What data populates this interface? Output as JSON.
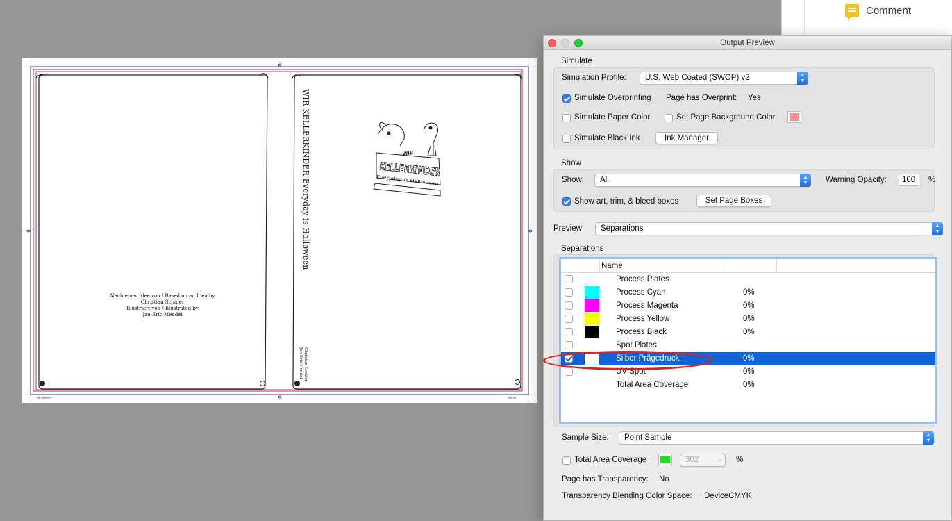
{
  "side_panel": {
    "comment_label": "Comment"
  },
  "document": {
    "credit_lines": [
      "Nach einer Idee von / Based on an Idea by",
      "Christian Schäfer",
      "Illustriert von / Illustrated by",
      "Jan-Eric Mendel"
    ],
    "spine_title": "WIR KELLERKINDER Everyday is Halloween",
    "spine_author_lines": [
      "Christian Schäfer",
      "Jan-Eric Mendel"
    ],
    "logo_word_top": "WIR",
    "logo_word_main": "KELLERKINDER",
    "logo_tagline": "Everyday is Halloween"
  },
  "dialog": {
    "title": "Output Preview",
    "simulate": {
      "section_label": "Simulate",
      "profile_label": "Simulation Profile:",
      "profile_value": "U.S. Web Coated (SWOP) v2",
      "overprint_label": "Simulate Overprinting",
      "overprint_checked": true,
      "page_overprint_label": "Page has Overprint:",
      "page_overprint_value": "Yes",
      "paper_color_label": "Simulate Paper Color",
      "bg_color_label": "Set Page Background Color",
      "bg_color": "#ee8f92",
      "black_ink_label": "Simulate Black Ink",
      "ink_manager_label": "Ink Manager"
    },
    "show": {
      "section_label": "Show",
      "show_label": "Show:",
      "show_value": "All",
      "warning_opacity_label": "Warning Opacity:",
      "warning_opacity_value": "100",
      "percent": "%",
      "boxes_label": "Show art, trim, & bleed boxes",
      "boxes_checked": true,
      "set_page_boxes_label": "Set Page Boxes"
    },
    "preview": {
      "label": "Preview:",
      "value": "Separations"
    },
    "separations": {
      "section_label": "Separations",
      "name_header": "Name",
      "rows": [
        {
          "name": "Process Plates",
          "color": "",
          "pct": ""
        },
        {
          "name": "Process Cyan",
          "color": "#00ffff",
          "pct": "0%"
        },
        {
          "name": "Process Magenta",
          "color": "#ff00ff",
          "pct": "0%"
        },
        {
          "name": "Process Yellow",
          "color": "#ffff00",
          "pct": "0%"
        },
        {
          "name": "Process Black",
          "color": "#000000",
          "pct": "0%"
        },
        {
          "name": "Spot Plates",
          "color": "",
          "pct": ""
        },
        {
          "name": "Silber Prägedruck",
          "color": "#ffffff",
          "pct": "0%"
        },
        {
          "name": "UV Spot",
          "color": "",
          "pct": "0%"
        },
        {
          "name": "Total Area Coverage",
          "color": "",
          "pct": "0%"
        }
      ]
    },
    "sample_size": {
      "label": "Sample Size:",
      "value": "Point Sample"
    },
    "tac": {
      "label": "Total Area Coverage",
      "color": "#22dd22",
      "value": "302",
      "percent": "%"
    },
    "transparency": {
      "label": "Page has Transparency:",
      "value": "No"
    },
    "blending": {
      "label": "Transparency Blending Color Space:",
      "value": "DeviceCMYK"
    }
  }
}
